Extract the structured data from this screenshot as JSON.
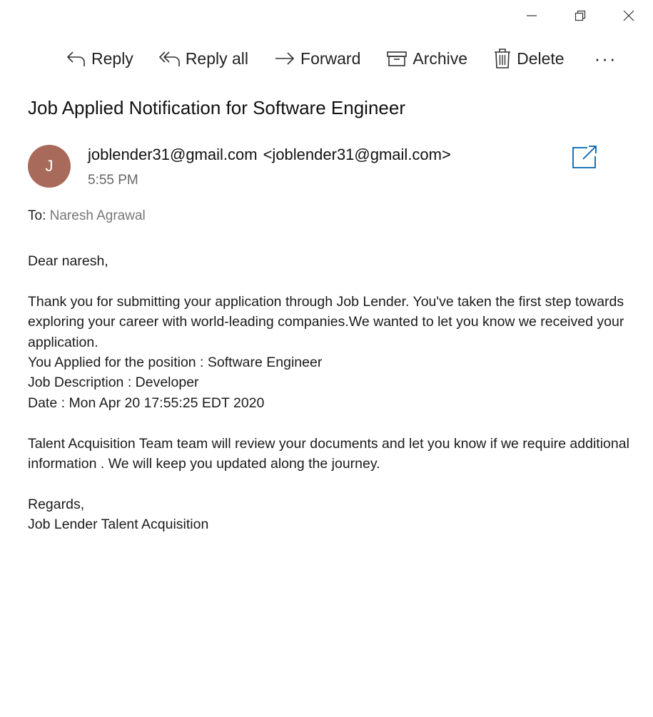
{
  "window_controls": {
    "minimize_icon": "minimize-icon",
    "restore_icon": "restore-icon",
    "close_icon": "close-icon"
  },
  "toolbar": {
    "reply_label": "Reply",
    "reply_all_label": "Reply all",
    "forward_label": "Forward",
    "archive_label": "Archive",
    "delete_label": "Delete",
    "more_label": "···"
  },
  "message": {
    "subject": "Job Applied Notification for Software Engineer",
    "avatar_initial": "J",
    "avatar_color": "#a86a5a",
    "sender_name": "joblender31@gmail.com",
    "sender_address": "<joblender31@gmail.com>",
    "time": "5:55 PM",
    "to_label": "To:",
    "to_name": "Naresh Agrawal"
  },
  "body": {
    "greeting": "Dear naresh,",
    "paragraph1": "Thank you for submitting your application through Job Lender. You've taken the first step towards exploring your career with world-leading companies.We wanted to let you know we received your application.",
    "position_line": "You Applied for the position : Software Engineer",
    "description_line": "Job Description : Developer",
    "date_line": "Date : Mon Apr 20 17:55:25 EDT 2020",
    "paragraph2": "Talent Acquisition Team team will review your documents and let you know if we require additional information . We will keep you updated along the journey.",
    "closing": "Regards,",
    "signature": "Job Lender Talent Acquisition"
  },
  "colors": {
    "accent": "#0063b1",
    "avatar": "#a86a5a",
    "muted_text": "#777777"
  }
}
